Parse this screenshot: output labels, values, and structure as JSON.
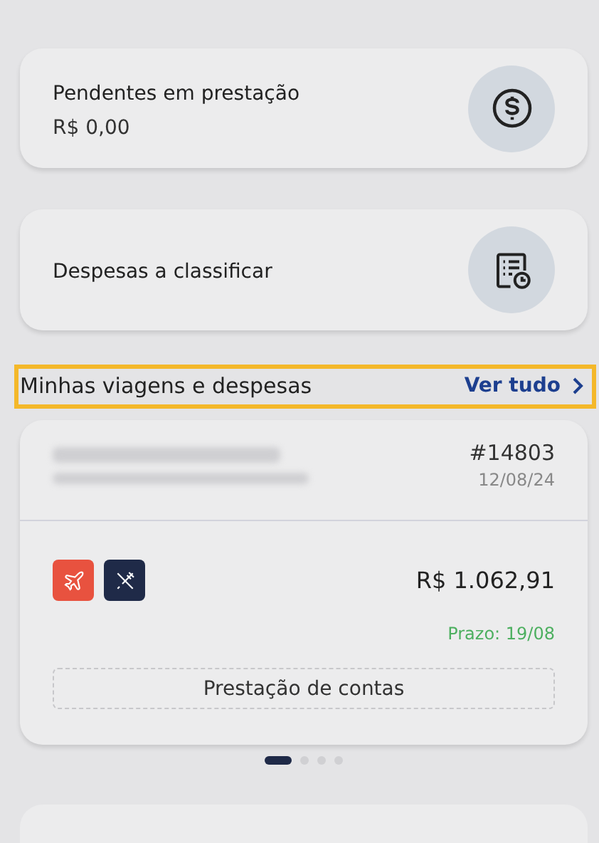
{
  "summary_cards": [
    {
      "kind": "money",
      "title": "Pendentes em prestação",
      "value": "R$ 0,00"
    },
    {
      "kind": "list",
      "title": "Despesas a classificar"
    }
  ],
  "section": {
    "title": "Minhas viagens e despesas",
    "link": "Ver tudo",
    "highlighted": true
  },
  "trip": {
    "number": "#14803",
    "date": "12/08/24",
    "redacted": true,
    "categories": [
      {
        "kind": "flight",
        "color": "#e8523f"
      },
      {
        "kind": "food",
        "color": "#1f2a48"
      }
    ],
    "amount": "R$ 1.062,91",
    "deadline": "Prazo: 19/08",
    "action": "Prestação de contas"
  },
  "pager": [
    {
      "selected": true
    },
    {
      "selected": false
    },
    {
      "selected": false
    },
    {
      "selected": false
    }
  ]
}
